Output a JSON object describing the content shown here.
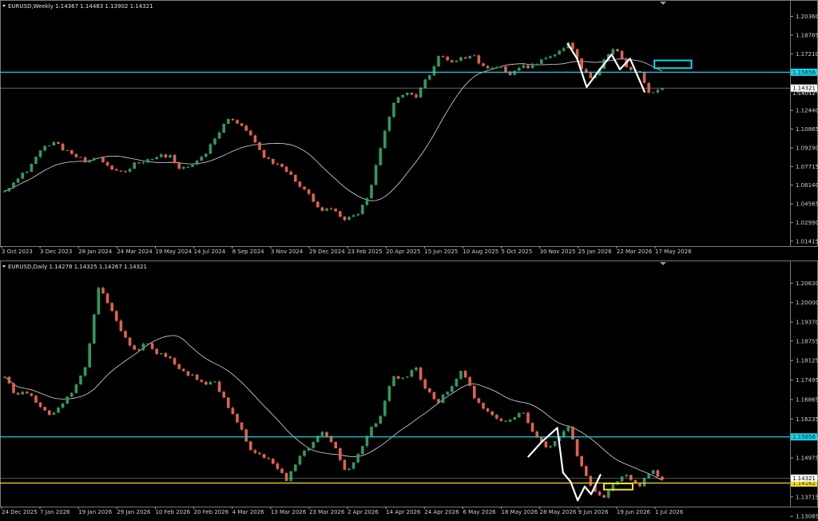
{
  "colors": {
    "background": "#000000",
    "bull": "#2f9a5f",
    "bear": "#e0614f",
    "ma": "#d8d8d8",
    "grid_border": "#7a7a7a",
    "cyan": "#18d2e6",
    "yellow": "#f2e218",
    "current_line": "#a0a0a0",
    "zigzag": "#ffffff"
  },
  "chart_data": [
    {
      "type": "candlestick",
      "title": "EURUSD,Weekly  1.14367 1.14483 1.13902 1.14321",
      "ylim": [
        1.01,
        1.208
      ],
      "y_ticks": [
        "1.20360",
        "1.18785",
        "1.17210",
        "1.15635",
        "1.14060",
        "1.12440",
        "1.10865",
        "1.09290",
        "1.07715",
        "1.06140",
        "1.04565",
        "1.02990",
        "1.01415"
      ],
      "x_ticks": [
        "3 Oct 2023",
        "3 Dec 2023",
        "28 Jan 2024",
        "24 Mar 2024",
        "19 May 2024",
        "14 Jul 2024",
        "8 Sep 2024",
        "3 Nov 2024",
        "29 Dec 2024",
        "23 Feb 2025",
        "20 Apr 2025",
        "15 Jun 2025",
        "10 Aug 2025",
        "5 Oct 2025",
        "30 Nov 2025",
        "25 Jan 2026",
        "22 Mar 2026",
        "17 May 2026"
      ],
      "anchor_closes": [
        1.058,
        1.065,
        1.075,
        1.09,
        1.098,
        1.092,
        1.086,
        1.08,
        1.084,
        1.076,
        1.072,
        1.079,
        1.083,
        1.085,
        1.087,
        1.074,
        1.078,
        1.087,
        1.101,
        1.118,
        1.112,
        1.104,
        1.085,
        1.079,
        1.074,
        1.062,
        1.052,
        1.04,
        1.041,
        1.032,
        1.036,
        1.052,
        1.092,
        1.128,
        1.14,
        1.136,
        1.152,
        1.17,
        1.166,
        1.168,
        1.17,
        1.158,
        1.162,
        1.155,
        1.16,
        1.163,
        1.17,
        1.17,
        1.182,
        1.162,
        1.15,
        1.165,
        1.178,
        1.16,
        1.157,
        1.138,
        1.143
      ],
      "levels": {
        "cyan": 1.15656,
        "current": 1.14321
      },
      "level_labels": {
        "cyan": "1.15656",
        "current": "1.14321",
        "current_alt": "1.14012"
      },
      "zigzag": [
        [
          1.181,
          0.888
        ],
        [
          1.168,
          0.903
        ],
        [
          1.144,
          0.918
        ],
        [
          1.157,
          0.936
        ],
        [
          1.1715,
          0.957
        ],
        [
          1.159,
          0.97
        ],
        [
          1.168,
          0.986
        ],
        [
          1.1395,
          1.009
        ]
      ],
      "zone": {
        "color": "cyan",
        "top": 1.1665,
        "bottom": 1.16,
        "x0": 1.024,
        "x1": 1.082
      }
    },
    {
      "type": "candlestick",
      "title": "EURUSD,Daily  1.14278 1.14325 1.14267 1.14321",
      "ylim": [
        1.134,
        1.21
      ],
      "y_ticks": [
        "1.20630",
        "1.20000",
        "1.19370",
        "1.18755",
        "1.18125",
        "1.17495",
        "1.16865",
        "1.16235",
        "1.15605",
        "1.14975",
        "1.14345",
        "1.13715",
        "1.13085"
      ],
      "x_ticks": [
        "24 Dec 2025",
        "7 Jan 2026",
        "19 Jan 2026",
        "29 Jan 2026",
        "10 Feb 2026",
        "20 Feb 2026",
        "4 Mar 2026",
        "13 Mar 2026",
        "23 Mar 2026",
        "2 Apr 2026",
        "14 Apr 2026",
        "24 Apr 2026",
        "6 May 2026",
        "18 May 2026",
        "28 May 2026",
        "9 Jun 2026",
        "19 Jun 2026",
        "1 Jul 2026"
      ],
      "anchor_closes": [
        1.176,
        1.17,
        1.171,
        1.166,
        1.164,
        1.168,
        1.172,
        1.181,
        1.205,
        1.198,
        1.19,
        1.184,
        1.187,
        1.183,
        1.183,
        1.178,
        1.176,
        1.174,
        1.174,
        1.166,
        1.16,
        1.152,
        1.15,
        1.148,
        1.142,
        1.15,
        1.153,
        1.158,
        1.155,
        1.145,
        1.15,
        1.158,
        1.163,
        1.176,
        1.175,
        1.179,
        1.171,
        1.168,
        1.173,
        1.178,
        1.169,
        1.165,
        1.162,
        1.162,
        1.165,
        1.158,
        1.153,
        1.155,
        1.16,
        1.148,
        1.14,
        1.136,
        1.142,
        1.144,
        1.14,
        1.146,
        1.143
      ],
      "levels": {
        "cyan": 1.15656,
        "yellow": 1.14162,
        "current": 1.14321
      },
      "level_labels": {
        "cyan": "1.15656",
        "yellow": "1.14162",
        "current": "1.14321"
      },
      "zigzag": [
        [
          1.15,
          0.826
        ],
        [
          1.155,
          0.848
        ],
        [
          1.1595,
          0.872
        ],
        [
          1.145,
          0.881
        ],
        [
          1.142,
          0.893
        ],
        [
          1.136,
          0.904
        ],
        [
          1.1405,
          0.915
        ],
        [
          1.138,
          0.925
        ],
        [
          1.1445,
          0.94
        ]
      ],
      "zone": {
        "color": "yellow",
        "top": 1.1415,
        "bottom": 1.1395,
        "x0": 0.945,
        "x1": 0.99
      }
    }
  ]
}
